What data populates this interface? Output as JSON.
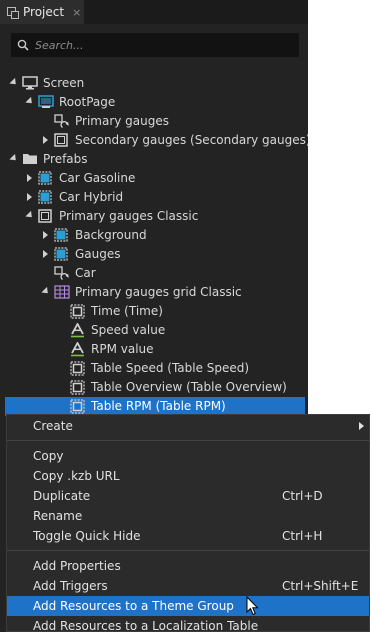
{
  "tab": {
    "label": "Project",
    "close": "×"
  },
  "search": {
    "placeholder": "Search..."
  },
  "tree": [
    {
      "label": "Screen",
      "indent": 0,
      "expander": "down",
      "icon": "screen-icon"
    },
    {
      "label": "RootPage",
      "indent": 1,
      "expander": "down",
      "icon": "page-icon"
    },
    {
      "label": "Primary gauges",
      "indent": 2,
      "expander": "none",
      "icon": "prefab-instance-icon"
    },
    {
      "label": "Secondary gauges (Secondary gauges)",
      "indent": 2,
      "expander": "right",
      "icon": "node-icon"
    },
    {
      "label": "Prefabs",
      "indent": 0,
      "expander": "down",
      "icon": "folder-icon"
    },
    {
      "label": "Car Gasoline",
      "indent": 1,
      "expander": "right",
      "icon": "prefab-blue-icon"
    },
    {
      "label": "Car Hybrid",
      "indent": 1,
      "expander": "right",
      "icon": "prefab-blue-icon"
    },
    {
      "label": "Primary gauges Classic",
      "indent": 1,
      "expander": "down",
      "icon": "node-icon"
    },
    {
      "label": "Background",
      "indent": 2,
      "expander": "right",
      "icon": "prefab-blue-icon"
    },
    {
      "label": "Gauges",
      "indent": 2,
      "expander": "right",
      "icon": "prefab-blue-icon"
    },
    {
      "label": "Car",
      "indent": 2,
      "expander": "none",
      "icon": "prefab-instance-icon"
    },
    {
      "label": "Primary gauges grid Classic",
      "indent": 2,
      "expander": "down",
      "icon": "grid-layout-icon"
    },
    {
      "label": "Time (Time)",
      "indent": 3,
      "expander": "none",
      "icon": "node-dashed-icon"
    },
    {
      "label": "Speed value",
      "indent": 3,
      "expander": "none",
      "icon": "text-block-icon"
    },
    {
      "label": "RPM value",
      "indent": 3,
      "expander": "none",
      "icon": "text-block-icon"
    },
    {
      "label": "Table Speed (Table Speed)",
      "indent": 3,
      "expander": "none",
      "icon": "node-dashed-icon"
    },
    {
      "label": "Table Overview (Table Overview)",
      "indent": 3,
      "expander": "none",
      "icon": "node-dashed-icon"
    },
    {
      "label": "Table RPM (Table RPM)",
      "indent": 3,
      "expander": "none",
      "icon": "node-dashed-icon",
      "selected": true
    }
  ],
  "context_menu": [
    {
      "label": "Create",
      "shortcut": "",
      "submenu": true
    },
    {
      "separator": true
    },
    {
      "label": "Copy",
      "shortcut": ""
    },
    {
      "label": "Copy .kzb URL",
      "shortcut": ""
    },
    {
      "label": "Duplicate",
      "shortcut": "Ctrl+D"
    },
    {
      "label": "Rename",
      "shortcut": ""
    },
    {
      "label": "Toggle Quick Hide",
      "shortcut": "Ctrl+H"
    },
    {
      "separator": true
    },
    {
      "label": "Add Properties",
      "shortcut": ""
    },
    {
      "label": "Add Triggers",
      "shortcut": "Ctrl+Shift+E"
    },
    {
      "label": "Add Resources to a Theme Group",
      "shortcut": "",
      "highlighted": true
    },
    {
      "label": "Add Resources to a Localization Table",
      "shortcut": ""
    }
  ],
  "colors": {
    "panel": "#232323",
    "selection": "#1e73c8",
    "icon_blue": "#2a9fd6"
  }
}
